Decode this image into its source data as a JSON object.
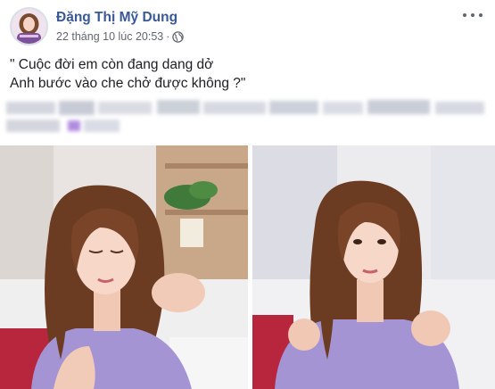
{
  "post": {
    "author_name": "Đặng Thị Mỹ Dung",
    "timestamp": "22 tháng 10 lúc 20:53",
    "separator": "·",
    "privacy_icon": "globe-icon",
    "more_icon": "more-horizontal-icon",
    "caption_lines": [
      "\" Cuộc đời em còn đang dang dở",
      "Anh bước vào che chở được không ?\""
    ]
  },
  "photos": [
    {
      "name": "photo-left",
      "subject": "woman-lavender-dress-eyes-closed"
    },
    {
      "name": "photo-right",
      "subject": "woman-lavender-dress-looking"
    }
  ],
  "colors": {
    "author_link": "#385898",
    "meta_text": "#616770",
    "dress": "#a594d4",
    "hair": "#6b3b22",
    "sofa": "#b8263e"
  }
}
